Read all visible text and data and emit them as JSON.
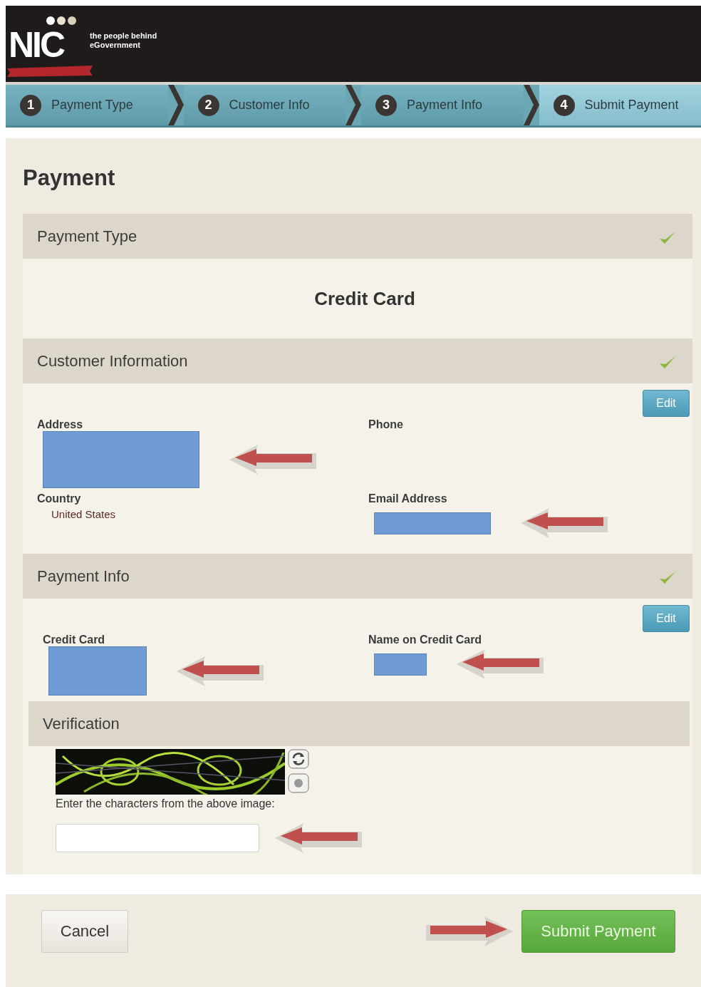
{
  "header": {
    "logo": "NIC",
    "tagline": "the people behind eGovernment"
  },
  "steps": [
    {
      "number": "1",
      "label": "Payment Type",
      "selected": false
    },
    {
      "number": "2",
      "label": "Customer Info",
      "selected": false
    },
    {
      "number": "3",
      "label": "Payment Info",
      "selected": false
    },
    {
      "number": "4",
      "label": "Submit Payment",
      "selected": true
    }
  ],
  "page_title": "Payment",
  "payment_type": {
    "title": "Payment Type",
    "complete": true,
    "value": "Credit Card"
  },
  "customer_information": {
    "title": "Customer Information",
    "complete": true,
    "edit_button": "Edit",
    "fields": [
      {
        "label": "Address",
        "redacted": true,
        "arrow": true
      },
      {
        "label": "Phone",
        "redacted": false
      },
      {
        "label": "Country",
        "value": "United States",
        "redacted": false
      },
      {
        "label": "Email Address",
        "redacted": true,
        "arrow": true
      }
    ]
  },
  "payment_info": {
    "title": "Payment Info",
    "complete": true,
    "edit_button": "Edit",
    "fields": [
      {
        "label": "Credit Card",
        "redacted": true,
        "arrow": true
      },
      {
        "label": "Name on Credit Card",
        "redacted": true,
        "arrow": true
      }
    ]
  },
  "verification": {
    "title": "Verification",
    "instructions": "Enter the characters from the above image:",
    "arrow": true
  },
  "buttons": {
    "cancel": "Cancel",
    "submit": "Submit Payment",
    "submit_arrow": true
  }
}
